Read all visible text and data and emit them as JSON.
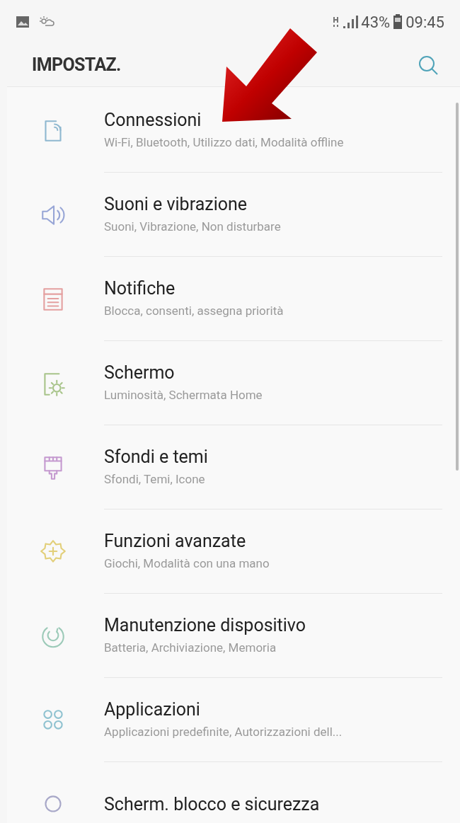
{
  "status_bar": {
    "battery": "43%",
    "time": "09:45"
  },
  "header": {
    "title": "IMPOSTAZ."
  },
  "items": [
    {
      "title": "Connessioni",
      "subtitle": "Wi-Fi, Bluetooth, Utilizzo dati, Modalità offline",
      "color": "#8fb8d0"
    },
    {
      "title": "Suoni e vibrazione",
      "subtitle": "Suoni, Vibrazione, Non disturbare",
      "color": "#98a6d6"
    },
    {
      "title": "Notifiche",
      "subtitle": "Blocca, consenti, assegna priorità",
      "color": "#e4a0a0"
    },
    {
      "title": "Schermo",
      "subtitle": "Luminosità, Schermata Home",
      "color": "#a8c48a"
    },
    {
      "title": "Sfondi e temi",
      "subtitle": "Sfondi, Temi, Icone",
      "color": "#c59ad0"
    },
    {
      "title": "Funzioni avanzate",
      "subtitle": "Giochi, Modalità con una mano",
      "color": "#e2cf7a"
    },
    {
      "title": "Manutenzione dispositivo",
      "subtitle": "Batteria, Archiviazione, Memoria",
      "color": "#9ccab8"
    },
    {
      "title": "Applicazioni",
      "subtitle": "Applicazioni predefinite, Autorizzazioni dell...",
      "color": "#8fc2d0"
    },
    {
      "title": "Scherm. blocco e sicurezza",
      "color": "#a8a8c8"
    }
  ]
}
